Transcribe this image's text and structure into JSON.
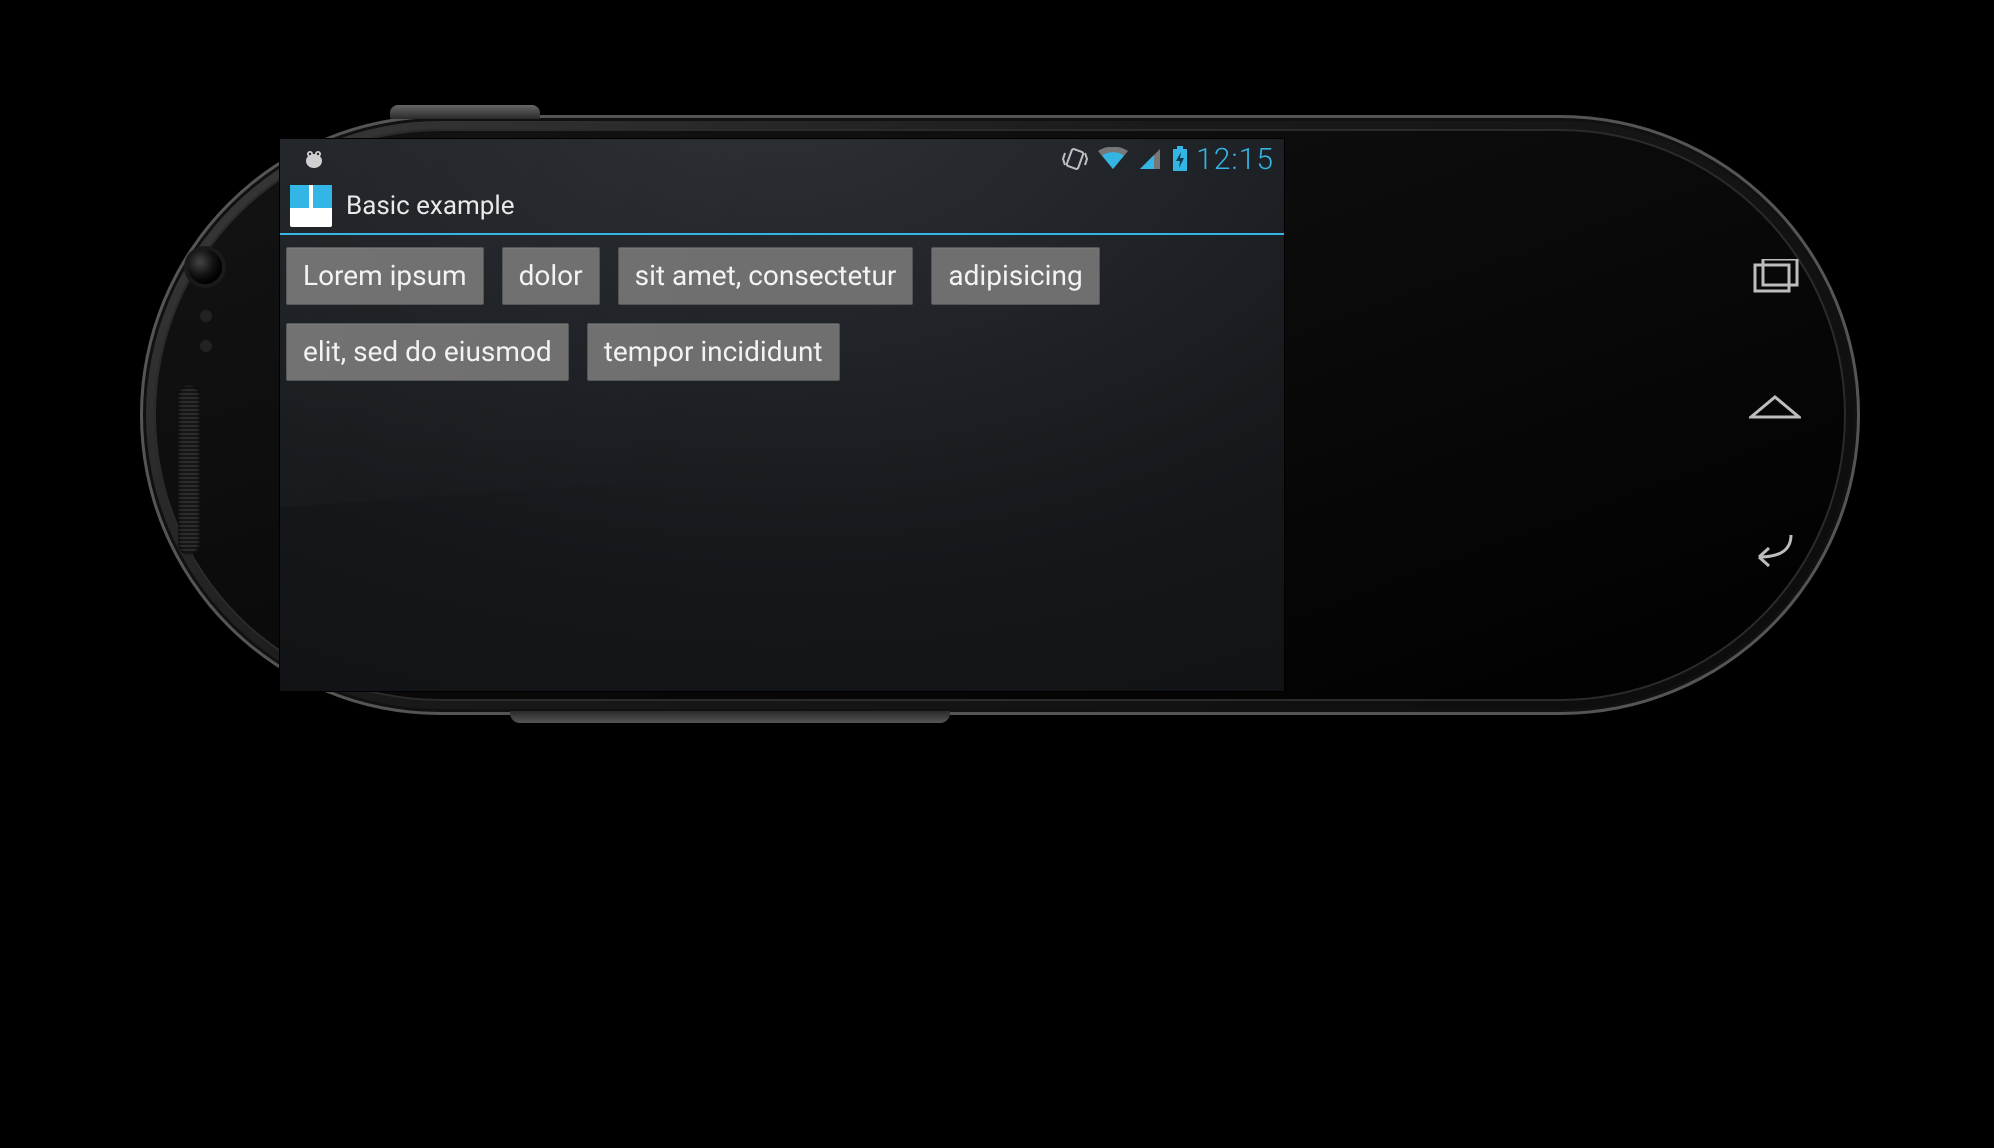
{
  "statusbar": {
    "time": "12:15"
  },
  "actionbar": {
    "title": "Basic example"
  },
  "chips": [
    "Lorem ipsum",
    "dolor",
    "sit amet, consectetur",
    "adipisicing",
    "elit, sed do eiusmod",
    "tempor incididunt"
  ]
}
